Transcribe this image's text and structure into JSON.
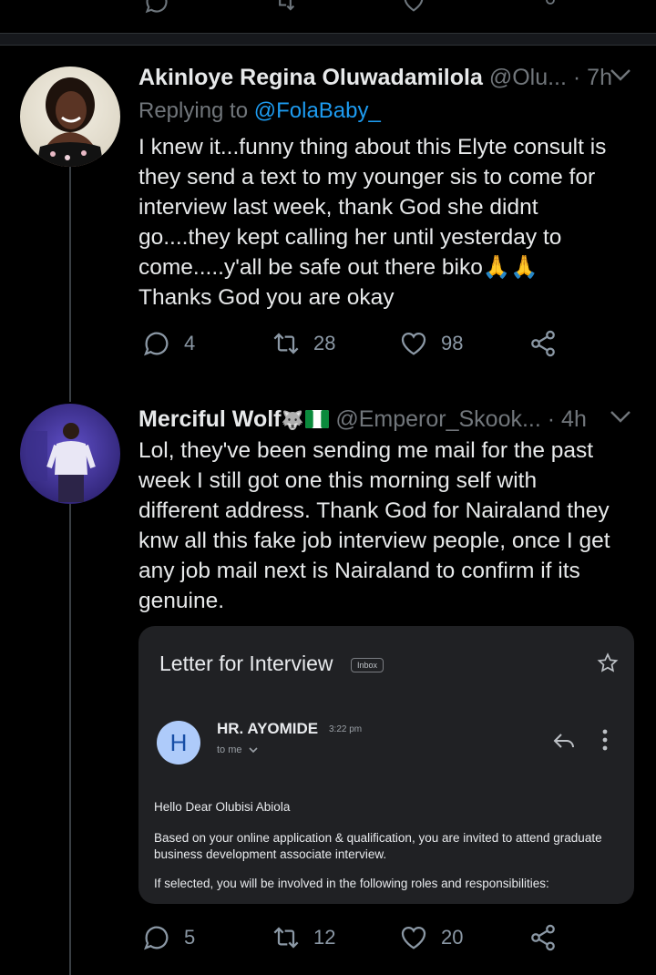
{
  "tweets": [
    {
      "name": "Akinloye Regina Oluwadamilola",
      "handle": "@Olu...",
      "time": "· 7h",
      "replying_prefix": "Replying to",
      "replying_to": "@FolaBaby_",
      "text": "I knew it...funny thing about this Elyte consult is\nthey send a text to  my younger sis to come for\ninterview last week, thank God she didnt\ngo....they kept calling her until yesterday to\ncome.....y'all be safe out there biko🙏🙏\nThanks God you are okay",
      "replies": "4",
      "retweets": "28",
      "likes": "98"
    },
    {
      "name": "Merciful Wolf",
      "name_emoji": "🐺",
      "handle": "@Emperor_Skook...",
      "time": "· 4h",
      "text": "Lol, they've been sending me mail for the past\nweek I still got one this morning self with\ndifferent address. Thank God for Nairaland they\nknw all this fake job interview people, once I get\nany job mail next is Nairaland to confirm if its\ngenuine.",
      "replies": "5",
      "retweets": "12",
      "likes": "20"
    }
  ],
  "email": {
    "subject": "Letter for Interview",
    "label": "Inbox",
    "avatar_letter": "H",
    "sender": "HR. AYOMIDE",
    "time": "3:22 pm",
    "to": "to me",
    "greeting": "Hello Dear Olubisi Abiola",
    "paragraph1": "Based on your online application & qualification, you are invited to attend graduate business development associate interview.",
    "paragraph2": "If selected, you will be involved in the following roles and responsibilities:"
  },
  "colors": {
    "background": "#000000",
    "link": "#1d9bf0",
    "muted": "#71767b",
    "card": "#202124"
  }
}
